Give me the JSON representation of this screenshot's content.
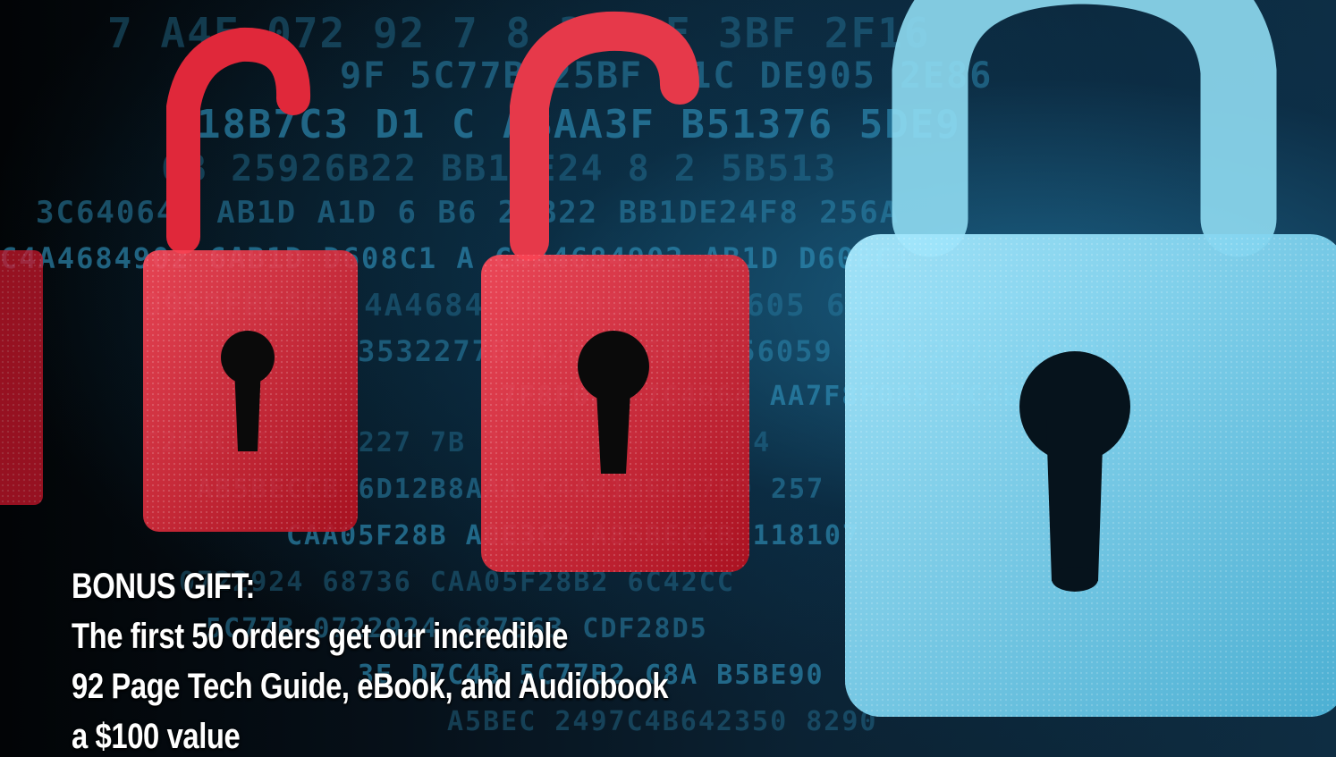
{
  "caption": {
    "line1": "BONUS GIFT:",
    "line2": "The first 50 orders get our incredible",
    "line3": "92 Page Tech Guide, eBook, and Audiobook",
    "line4": "a $100 value"
  },
  "background_hex": [
    "7 A4F 072 92 7 8 3F DF 3BF 2F16",
    "9F 5C77B 25BF A1C DE905 2E86",
    "18B7C3 D1 C ABAA3F B51376 5DE9",
    "6B 25926B22 BB1DE24 8 2 5B513",
    "3C64064F AB1D A1D 6 B6 26B22 BB1DE24F8 256A",
    "C4A4684902 6AB1D D608C1 A C4A4684902 AB1D D608C1",
    "095BFBC560 4A4684 90 5095BFBC5605 64B7E92DFF",
    "3532277B A2B5095BFBC56059 35322778 46806",
    "7F8F089 7C4B64 AA7F8F089 7C4B642",
    "C2E6C4E9 353227 7B 3C2E6C4E9 46F2F4",
    "AB5BECCB 6D12B8AAA C4A21BE4E7FD 257",
    "CAA05F28B A0E3C2 A85BECCB 118107",
    "0722924 68736 CAA05F28B2 6C42CC",
    "5C77B 0722924 687363 CDF28D5",
    "3E D7C4B 5C77B2 C8A B5BE90",
    "A5BEC 2497C4B642350 8290"
  ],
  "colors": {
    "lock_red": "#e0283a",
    "lock_blue": "#7fd4ee",
    "hex_blue": "#2f8fb8",
    "caption_text": "#ffffff"
  },
  "icons": [
    "padlock-open-icon",
    "padlock-open-icon",
    "padlock-closed-icon"
  ]
}
